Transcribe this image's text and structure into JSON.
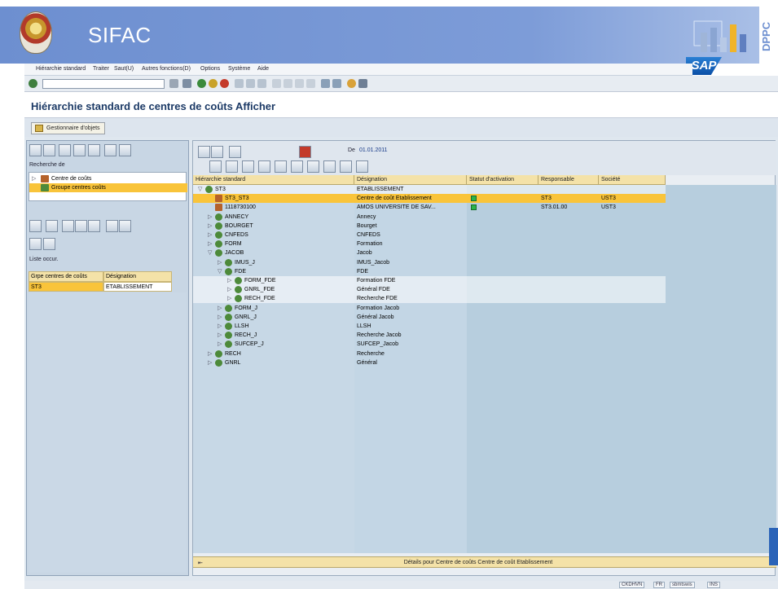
{
  "banner": {
    "title": "SIFAC",
    "side_text": "DPPC",
    "sap_logo": "SAP",
    "colors": {
      "banner": "#6d8fd0",
      "accent": "#f9c43a"
    }
  },
  "menubar": {
    "items": [
      "Hiérarchie standard",
      "Traiter",
      "Saut(U)",
      "Autres fonctions(D)",
      "Options",
      "Système",
      "Aide"
    ]
  },
  "page": {
    "title": "Hiérarchie standard de centres de coûts Afficher"
  },
  "appbar": {
    "gestion_label": "Gestionnaire d'objets"
  },
  "left_pane": {
    "search_label": "Recherche de",
    "tree": [
      {
        "label": "Centre de coûts",
        "selected": false
      },
      {
        "label": "Groupe centres coûts",
        "selected": true
      }
    ],
    "list_label": "Liste occur.",
    "table": {
      "headers": [
        "Grpe centres de coûts",
        "Désignation"
      ],
      "rows": [
        [
          "ST3",
          "ETABLISSEMENT"
        ]
      ]
    }
  },
  "right_pane": {
    "date_label": "De",
    "date_value": "01.01.2011",
    "columns": [
      "Hiérarchie standard",
      "Désignation",
      "Statut d'activation",
      "Responsable",
      "Société"
    ],
    "rows": [
      {
        "name": "ST3",
        "designation": "ETABLISSEMENT",
        "status": false,
        "responsable": "",
        "societe": "",
        "indent": 0,
        "exp": "▽",
        "icon": "group",
        "style": "alt"
      },
      {
        "name": "ST3_ST3",
        "designation": "Centre de coût Etablissement",
        "status": true,
        "responsable": "ST3",
        "societe": "UST3",
        "indent": 1,
        "exp": "",
        "icon": "center",
        "style": "sel"
      },
      {
        "name": "1118730100",
        "designation": "AMOS UNIVERSITE DE SAV...",
        "status": true,
        "responsable": "ST3.01.00",
        "societe": "UST3",
        "indent": 1,
        "exp": "",
        "icon": "center",
        "style": ""
      },
      {
        "name": "ANNECY",
        "designation": "Annecy",
        "status": false,
        "responsable": "",
        "societe": "",
        "indent": 1,
        "exp": "▷",
        "icon": "group",
        "style": ""
      },
      {
        "name": "BOURGET",
        "designation": "Bourget",
        "status": false,
        "responsable": "",
        "societe": "",
        "indent": 1,
        "exp": "▷",
        "icon": "group",
        "style": ""
      },
      {
        "name": "CNFEDS",
        "designation": "CNFEDS",
        "status": false,
        "responsable": "",
        "societe": "",
        "indent": 1,
        "exp": "▷",
        "icon": "group",
        "style": ""
      },
      {
        "name": "FORM",
        "designation": "Formation",
        "status": false,
        "responsable": "",
        "societe": "",
        "indent": 1,
        "exp": "▷",
        "icon": "group",
        "style": ""
      },
      {
        "name": "JACOB",
        "designation": "Jacob",
        "status": false,
        "responsable": "",
        "societe": "",
        "indent": 1,
        "exp": "▽",
        "icon": "group",
        "style": ""
      },
      {
        "name": "IMUS_J",
        "designation": "IMUS_Jacob",
        "status": false,
        "responsable": "",
        "societe": "",
        "indent": 2,
        "exp": "▷",
        "icon": "group",
        "style": ""
      },
      {
        "name": "FDE",
        "designation": "FDE",
        "status": false,
        "responsable": "",
        "societe": "",
        "indent": 2,
        "exp": "▽",
        "icon": "group",
        "style": ""
      },
      {
        "name": "FORM_FDE",
        "designation": "Formation FDE",
        "status": false,
        "responsable": "",
        "societe": "",
        "indent": 3,
        "exp": "▷",
        "icon": "group",
        "style": "alt"
      },
      {
        "name": "GNRL_FDE",
        "designation": "Général FDE",
        "status": false,
        "responsable": "",
        "societe": "",
        "indent": 3,
        "exp": "▷",
        "icon": "group",
        "style": "alt"
      },
      {
        "name": "RECH_FDE",
        "designation": "Recherche FDE",
        "status": false,
        "responsable": "",
        "societe": "",
        "indent": 3,
        "exp": "▷",
        "icon": "group",
        "style": "alt"
      },
      {
        "name": "FORM_J",
        "designation": "Formation Jacob",
        "status": false,
        "responsable": "",
        "societe": "",
        "indent": 2,
        "exp": "▷",
        "icon": "group",
        "style": ""
      },
      {
        "name": "GNRL_J",
        "designation": "Général Jacob",
        "status": false,
        "responsable": "",
        "societe": "",
        "indent": 2,
        "exp": "▷",
        "icon": "group",
        "style": ""
      },
      {
        "name": "LLSH",
        "designation": "LLSH",
        "status": false,
        "responsable": "",
        "societe": "",
        "indent": 2,
        "exp": "▷",
        "icon": "group",
        "style": ""
      },
      {
        "name": "RECH_J",
        "designation": "Recherche Jacob",
        "status": false,
        "responsable": "",
        "societe": "",
        "indent": 2,
        "exp": "▷",
        "icon": "group",
        "style": ""
      },
      {
        "name": "SUFCEP_J",
        "designation": "SUFCEP_Jacob",
        "status": false,
        "responsable": "",
        "societe": "",
        "indent": 2,
        "exp": "▷",
        "icon": "group",
        "style": ""
      },
      {
        "name": "RECH",
        "designation": "Recherche",
        "status": false,
        "responsable": "",
        "societe": "",
        "indent": 1,
        "exp": "▷",
        "icon": "group",
        "style": ""
      },
      {
        "name": "GNRL",
        "designation": "Général",
        "status": false,
        "responsable": "",
        "societe": "",
        "indent": 1,
        "exp": "▷",
        "icon": "group",
        "style": ""
      }
    ],
    "detail_text": "Détails pour Centre de coûts Centre de coût Etablissement"
  },
  "statusbar": {
    "items": [
      "CKDHVN",
      "FR",
      "sbmtswis",
      "INS"
    ]
  }
}
